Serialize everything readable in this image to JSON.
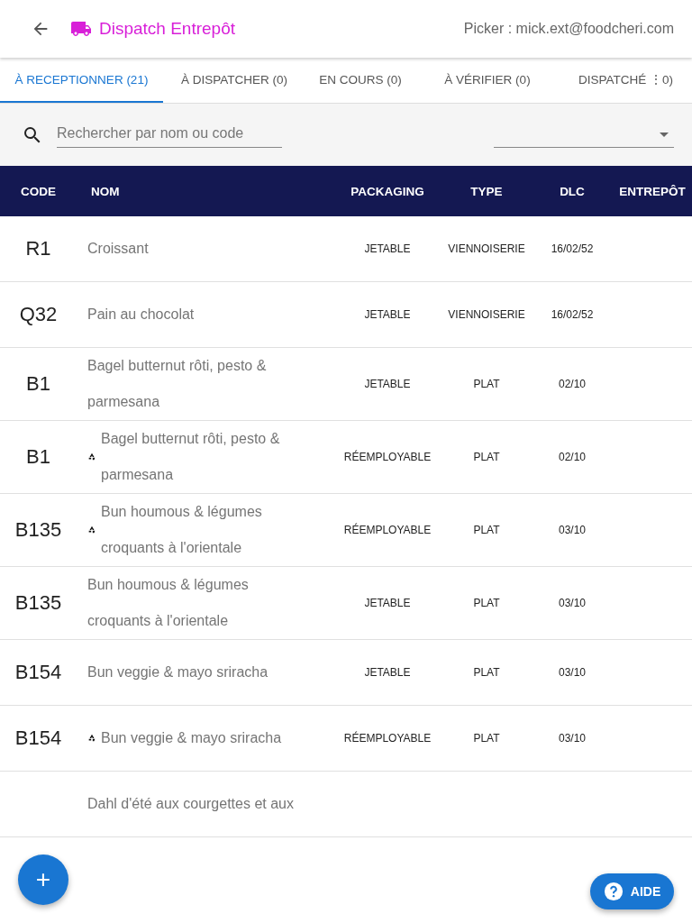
{
  "header": {
    "title": "Dispatch Entrepôt",
    "user": "Picker : mick.ext@foodcheri.com"
  },
  "tabs": [
    {
      "label": "À RECEPTIONNER (21)",
      "selected": true
    },
    {
      "label": "À DISPATCHER (0)",
      "selected": false
    },
    {
      "label": "EN COURS (0)",
      "selected": false
    },
    {
      "label": "À VÉRIFIER (0)",
      "selected": false
    },
    {
      "label": "DISPATCHÉ ⋮0)",
      "selected": false
    }
  ],
  "search": {
    "placeholder": "Rechercher par nom ou code"
  },
  "table": {
    "columns": [
      "CODE",
      "NOM",
      "PACKAGING",
      "TYPE",
      "DLC",
      "ENTREPÔT"
    ],
    "rows": [
      {
        "code": "R1",
        "name": "Croissant",
        "reusable": false,
        "packaging": "JETABLE",
        "type": "VIENNOISERIE",
        "dlc": "16/02/52"
      },
      {
        "code": "Q32",
        "name": "Pain au chocolat",
        "reusable": false,
        "packaging": "JETABLE",
        "type": "VIENNOISERIE",
        "dlc": "16/02/52"
      },
      {
        "code": "B1",
        "name": "Bagel butternut rôti, pesto & parmesana",
        "reusable": false,
        "packaging": "JETABLE",
        "type": "PLAT",
        "dlc": "02/10"
      },
      {
        "code": "B1",
        "name": "Bagel butternut rôti, pesto & parmesana",
        "reusable": true,
        "packaging": "RÉEMPLOYABLE",
        "type": "PLAT",
        "dlc": "02/10"
      },
      {
        "code": "B135",
        "name": "Bun houmous & légumes croquants à l'orientale",
        "reusable": true,
        "packaging": "RÉEMPLOYABLE",
        "type": "PLAT",
        "dlc": "03/10"
      },
      {
        "code": "B135",
        "name": "Bun houmous & légumes croquants à l'orientale",
        "reusable": false,
        "packaging": "JETABLE",
        "type": "PLAT",
        "dlc": "03/10"
      },
      {
        "code": "B154",
        "name": "Bun veggie & mayo sriracha",
        "reusable": false,
        "packaging": "JETABLE",
        "type": "PLAT",
        "dlc": "03/10"
      },
      {
        "code": "B154",
        "name": "Bun veggie & mayo sriracha",
        "reusable": true,
        "packaging": "RÉEMPLOYABLE",
        "type": "PLAT",
        "dlc": "03/10"
      },
      {
        "code": "",
        "name": "Dahl d'été aux courgettes et aux",
        "reusable": false,
        "packaging": "",
        "type": "",
        "dlc": ""
      }
    ]
  },
  "fab": {
    "label": "+"
  },
  "help_button": {
    "label": "AIDE"
  }
}
